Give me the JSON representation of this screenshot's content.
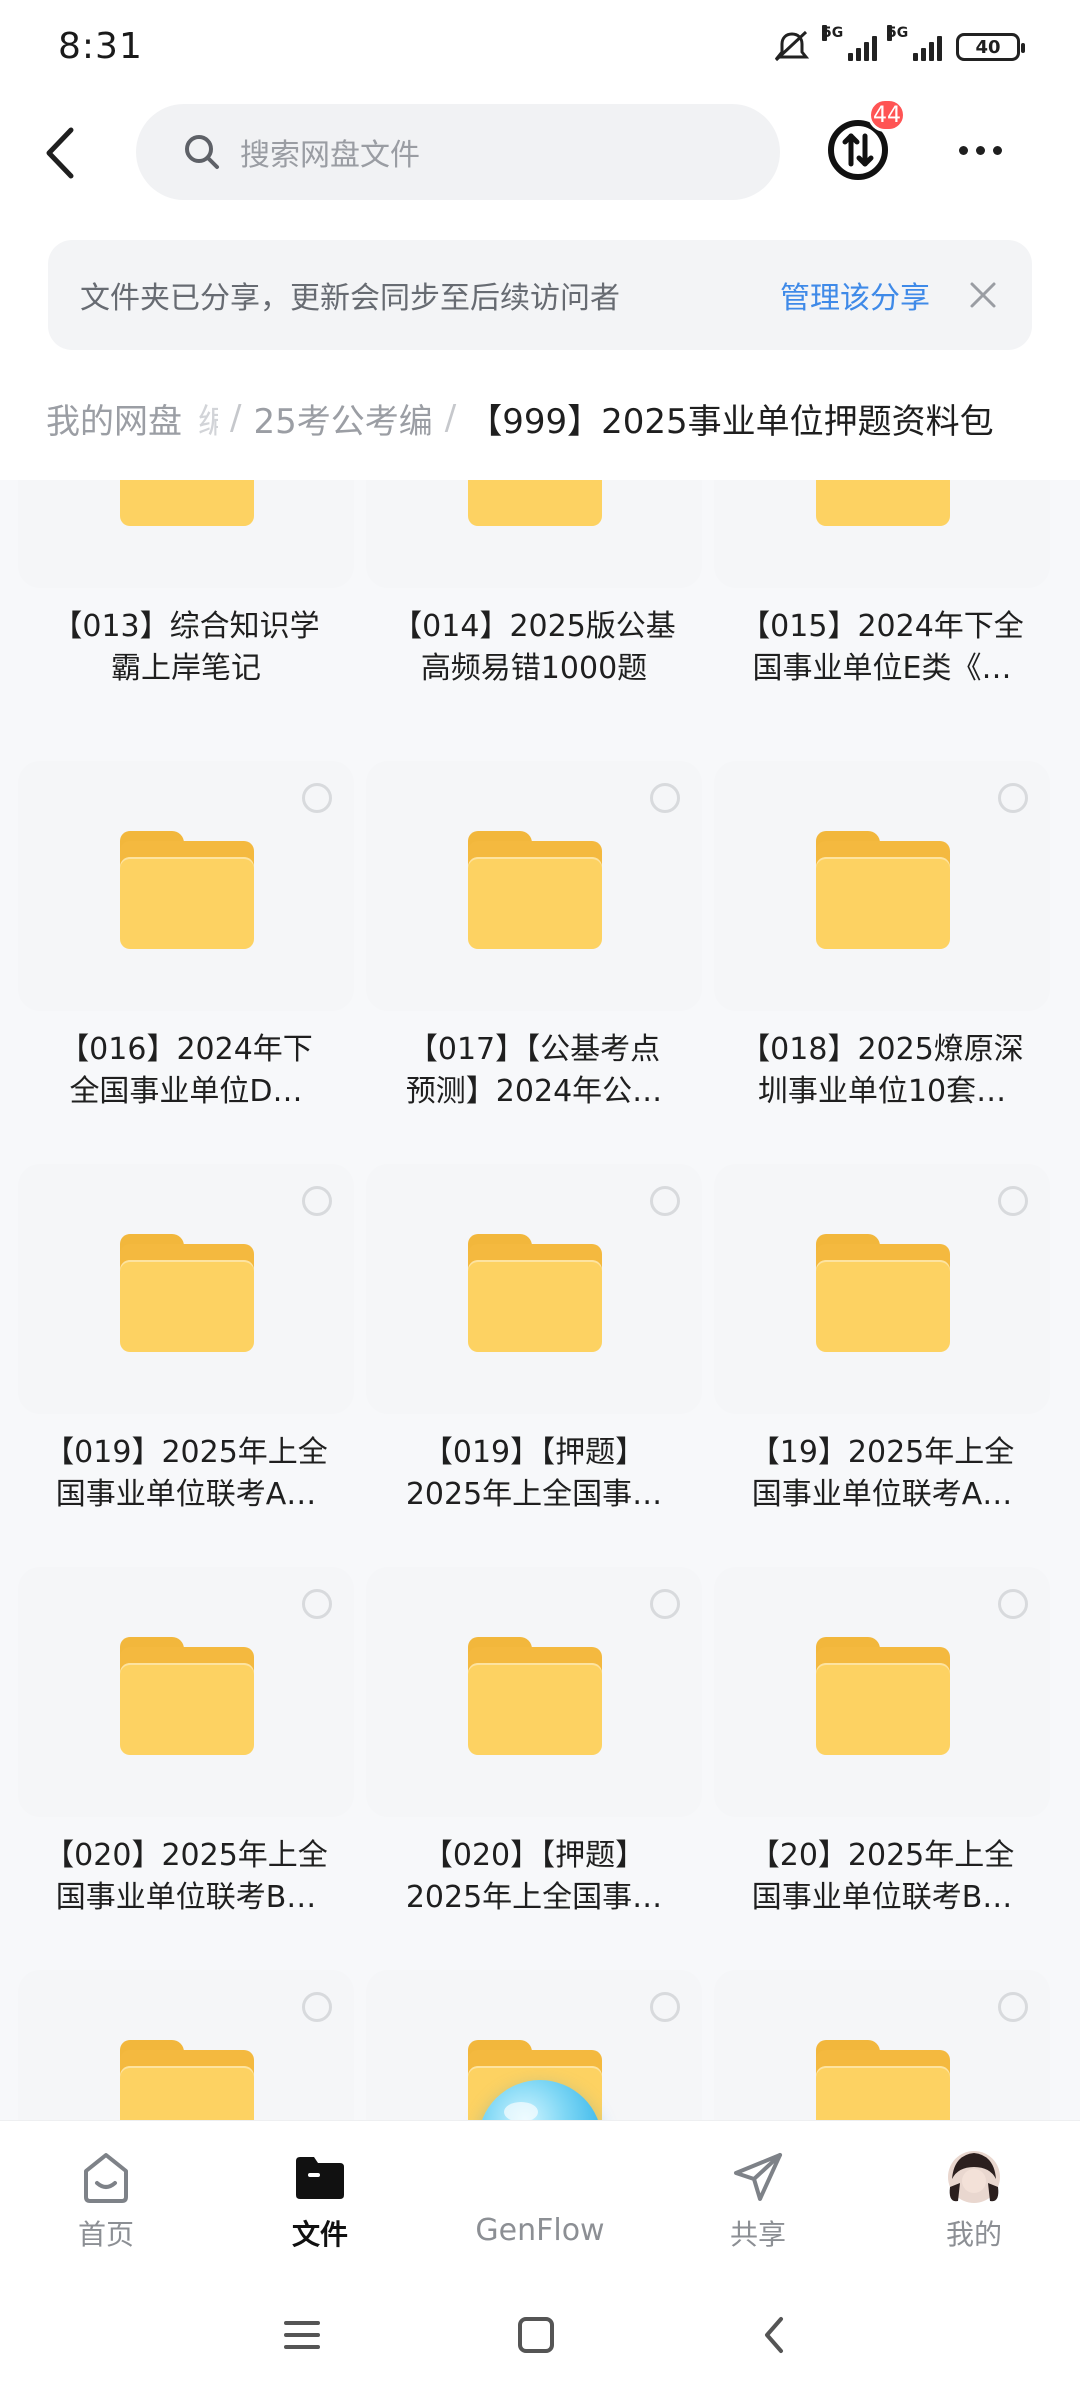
{
  "status_bar": {
    "time": "8:31",
    "signal1_label": "5G",
    "signal2_label": "5G",
    "battery": "40"
  },
  "header": {
    "search_placeholder": "搜索网盘文件",
    "transfer_badge": "44"
  },
  "notice": {
    "text": "文件夹已分享，更新会同步至后续访问者",
    "link": "管理该分享"
  },
  "breadcrumb": {
    "root": "我的网盘",
    "fade_fragment": "编",
    "sep": "/",
    "middle": "25考公考编",
    "current": "【999】2025事业单位押题资料包"
  },
  "folders": [
    {
      "line1": "【013】综合知识学",
      "line2": "霸上岸笔记"
    },
    {
      "line1": "【014】2025版公基",
      "line2": "高频易错1000题"
    },
    {
      "line1": "【015】2024年下全",
      "line2": "国事业单位E类《…"
    },
    {
      "line1": "【016】2024年下",
      "line2": "全国事业单位D…"
    },
    {
      "line1": "【017】【公基考点",
      "line2": "预测】2024年公…"
    },
    {
      "line1": "【018】2025燎原深",
      "line2": "圳事业单位10套…"
    },
    {
      "line1": "【019】2025年上全",
      "line2": "国事业单位联考A…"
    },
    {
      "line1": "【019】【押题】",
      "line2": "2025年上全国事…"
    },
    {
      "line1": "【19】2025年上全",
      "line2": "国事业单位联考A…"
    },
    {
      "line1": "【020】2025年上全",
      "line2": "国事业单位联考B…"
    },
    {
      "line1": "【020】【押题】",
      "line2": "2025年上全国事…"
    },
    {
      "line1": "【20】2025年上全",
      "line2": "国事业单位联考B…"
    }
  ],
  "bottom_nav": {
    "home": "首页",
    "files": "文件",
    "genflow": "GenFlow",
    "share": "共享",
    "mine": "我的"
  },
  "icons": {
    "back": "chevron-left-icon",
    "search": "search-icon",
    "transfer": "transfer-icon",
    "more": "more-icon",
    "close": "close-icon",
    "folder": "folder-icon"
  },
  "colors": {
    "accent_link": "#3f8ae8",
    "badge": "#ff5454",
    "folder": "#fdd262"
  }
}
